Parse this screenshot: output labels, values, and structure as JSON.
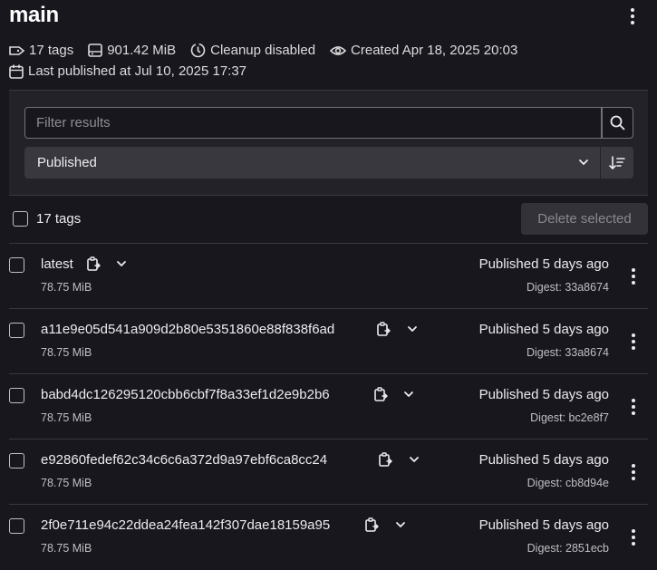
{
  "header": {
    "title": "main",
    "tags_count": "17 tags",
    "size": "901.42 MiB",
    "cleanup": "Cleanup disabled",
    "created": "Created Apr 18, 2025 20:03",
    "last_published": "Last published at Jul 10, 2025 17:37"
  },
  "filter": {
    "placeholder": "Filter results",
    "sort_label": "Published"
  },
  "list": {
    "select_all_label": "17 tags",
    "delete_label": "Delete selected",
    "rows": [
      {
        "name": "latest",
        "size": "78.75 MiB",
        "published": "Published 5 days ago",
        "digest": "Digest: 33a8674"
      },
      {
        "name": "a11e9e05d541a909d2b80e5351860e88f838f6ad",
        "size": "78.75 MiB",
        "published": "Published 5 days ago",
        "digest": "Digest: 33a8674"
      },
      {
        "name": "babd4dc126295120cbb6cbf7f8a33ef1d2e9b2b6",
        "size": "78.75 MiB",
        "published": "Published 5 days ago",
        "digest": "Digest: bc2e8f7"
      },
      {
        "name": "e92860fedef62c34c6c6a372d9a97ebf6ca8cc24",
        "size": "78.75 MiB",
        "published": "Published 5 days ago",
        "digest": "Digest: cb8d94e"
      },
      {
        "name": "2f0e711e94c22ddea24fea142f307dae18159a95",
        "size": "78.75 MiB",
        "published": "Published 5 days ago",
        "digest": "Digest: 2851ecb"
      }
    ]
  },
  "icons": {
    "tag": "tag-icon",
    "disk": "disk-icon",
    "cleanup": "clock-icon",
    "created": "eye-icon",
    "calendar": "calendar-icon",
    "search": "search-icon",
    "chevron": "chevron-down-icon",
    "sort": "sort-direction-icon",
    "copy": "copy-icon",
    "more": "more-actions-icon"
  },
  "colors": {
    "background": "#18171d",
    "panel": "#232228",
    "text": "#ececef",
    "muted": "#bfbfc3"
  }
}
